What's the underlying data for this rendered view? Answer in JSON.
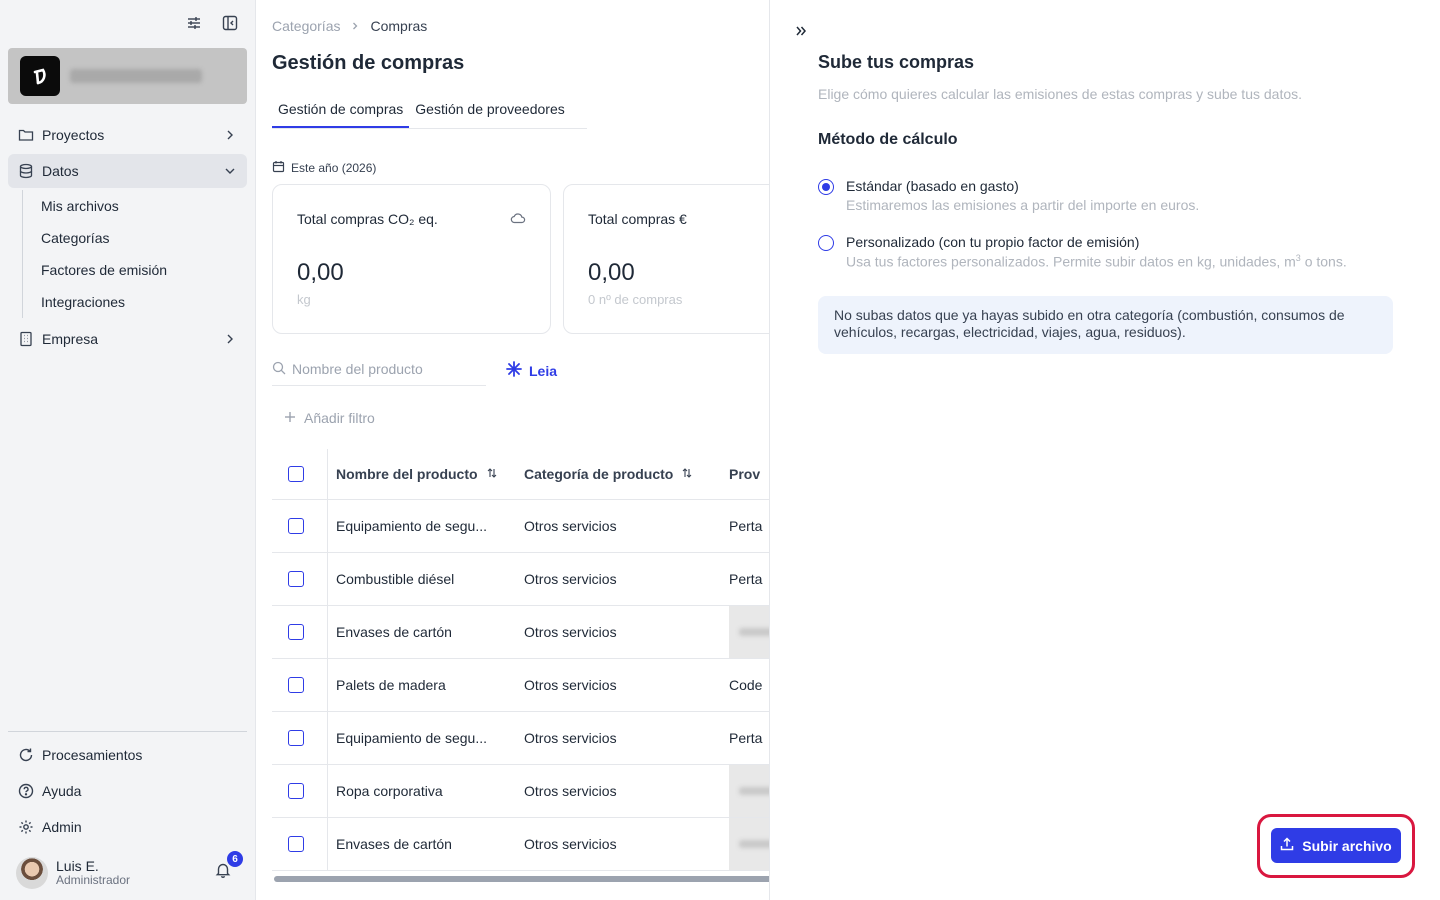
{
  "sidebar": {
    "nav": {
      "proyectos": "Proyectos",
      "datos": "Datos",
      "datos_children": [
        "Mis archivos",
        "Categorías",
        "Factores de emisión",
        "Integraciones"
      ],
      "empresa": "Empresa"
    },
    "bottom": {
      "procesamientos": "Procesamientos",
      "ayuda": "Ayuda",
      "admin": "Admin"
    },
    "user": {
      "name": "Luis E.",
      "role": "Administrador",
      "notifications": "6"
    }
  },
  "main": {
    "breadcrumb": [
      "Categorías",
      "Compras"
    ],
    "title": "Gestión de compras",
    "tabs": [
      "Gestión de compras",
      "Gestión de proveedores"
    ],
    "period": "Este año (2026)",
    "kpis": [
      {
        "title": "Total compras CO₂ eq.",
        "value": "0,00",
        "unit": "kg"
      },
      {
        "title": "Total compras €",
        "value": "0,00",
        "unit": "0 nº de compras"
      }
    ],
    "search_placeholder": "Nombre del producto",
    "leia": "Leia",
    "add_filter": "Añadir filtro",
    "table": {
      "headers": [
        "Nombre del producto",
        "Categoría de producto",
        "Prov"
      ],
      "rows": [
        {
          "name": "Equipamiento de segu...",
          "category": "Otros servicios",
          "provider": "Perta",
          "blurred": false
        },
        {
          "name": "Combustible diésel",
          "category": "Otros servicios",
          "provider": "Perta",
          "blurred": false
        },
        {
          "name": "Envases de cartón",
          "category": "Otros servicios",
          "provider": "",
          "blurred": true
        },
        {
          "name": "Palets de madera",
          "category": "Otros servicios",
          "provider": "Code",
          "blurred": false
        },
        {
          "name": "Equipamiento de segu...",
          "category": "Otros servicios",
          "provider": "Perta",
          "blurred": false
        },
        {
          "name": "Ropa corporativa",
          "category": "Otros servicios",
          "provider": "",
          "blurred": true
        },
        {
          "name": "Envases de cartón",
          "category": "Otros servicios",
          "provider": "",
          "blurred": true
        }
      ]
    }
  },
  "panel": {
    "title": "Sube tus compras",
    "subtitle": "Elige cómo quieres calcular las emisiones de estas compras y sube tus datos.",
    "method_heading": "Método de cálculo",
    "options": [
      {
        "label": "Estándar (basado en gasto)",
        "desc": "Estimaremos las emisiones a partir del importe en euros.",
        "selected": true
      },
      {
        "label": "Personalizado (con tu propio factor de emisión)",
        "desc_pre": "Usa tus factores personalizados. Permite subir datos en kg, unidades, m",
        "desc_sup": "3",
        "desc_post": " o tons.",
        "selected": false
      }
    ],
    "note": "No subas datos que ya hayas subido en otra categoría (combustión, consumos de vehículos, recargas, electricidad, viajes, agua, residuos).",
    "upload_button": "Subir archivo"
  },
  "colors": {
    "accent": "#2f3ce6",
    "highlight": "#d9173f",
    "note_bg": "#eef3fc"
  }
}
